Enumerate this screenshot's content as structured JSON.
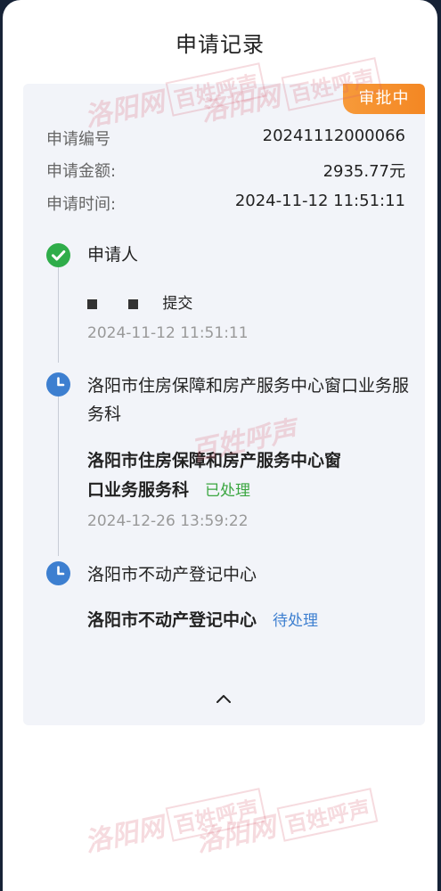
{
  "header": {
    "title": "申请记录"
  },
  "record": {
    "status": "审批中",
    "fields": [
      {
        "label": "申请编号",
        "value": "20241112000066"
      },
      {
        "label": "申请金额:",
        "value": "2935.77元"
      },
      {
        "label": "申请时间:",
        "value": "2024-11-12 11:51:11"
      }
    ]
  },
  "timeline": {
    "steps": [
      {
        "title": "申请人",
        "action": "提交",
        "time": "2024-11-12 11:51:11",
        "state_icon": "check-circle-icon"
      },
      {
        "title": "洛阳市住房保障和房产服务中心窗口业务服务科",
        "handler_line1": "洛阳市住房保障和房产服务中心窗",
        "handler_line2": "口业务服务科",
        "status": "已处理",
        "time": "2024-12-26 13:59:22",
        "state_icon": "clock-icon"
      },
      {
        "title": "洛阳市不动产登记中心",
        "handler": "洛阳市不动产登记中心",
        "status": "待处理",
        "state_icon": "clock-icon"
      }
    ]
  },
  "watermark": {
    "text": "洛阳网",
    "box_text": "百姓呼声"
  },
  "colors": {
    "status_badge": "#f48723",
    "done": "#3aa640",
    "pending": "#3d7fd0",
    "check": "#2fad4a",
    "clock": "#3d7fd0"
  }
}
